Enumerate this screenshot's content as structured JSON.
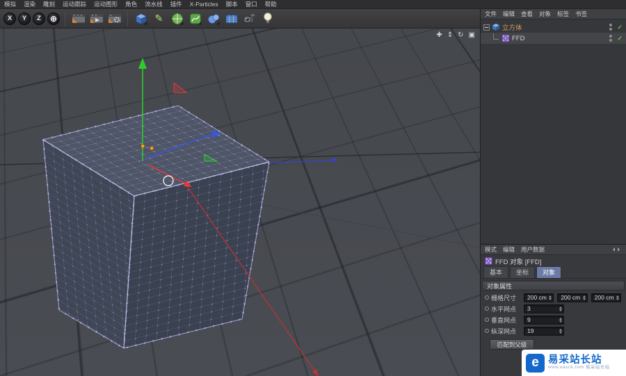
{
  "colors": {
    "axis_x": "#e03c3c",
    "axis_y": "#2ecc2e",
    "axis_z": "#3c55e0",
    "ffd_points": "#c79df2",
    "selected_points": "#ffa228",
    "check_green": "#6dc24f",
    "active_tab": "#6b7ba6",
    "brand_blue": "#1368cb"
  },
  "menubar": {
    "items": [
      "模拟",
      "渲染",
      "雕刻",
      "运动跟踪",
      "运动图形",
      "角色",
      "流水线",
      "插件",
      "X-Particles",
      "脚本",
      "窗口",
      "帮助"
    ]
  },
  "toolbar": {
    "axis_locks": [
      "X",
      "Y",
      "Z"
    ],
    "coord_glyph": "⊕",
    "pen_glyph": "✎"
  },
  "viewport": {
    "controls": [
      {
        "name": "pan-view",
        "glyph": "✚"
      },
      {
        "name": "zoom-view",
        "glyph": "⇕"
      },
      {
        "name": "rotate-view",
        "glyph": "↻"
      },
      {
        "name": "maximize-view",
        "glyph": "▣"
      }
    ]
  },
  "object_manager": {
    "menu": [
      "文件",
      "编辑",
      "查看",
      "对象",
      "标签",
      "书签"
    ],
    "objects": [
      {
        "name": "立方体",
        "enabled_glyph": "✓"
      },
      {
        "name": "FFD",
        "enabled_glyph": "✓"
      }
    ]
  },
  "attribute_manager": {
    "menu": [
      "模式",
      "编辑",
      "用户数据"
    ],
    "title": "FFD 对象 [FFD]",
    "tabs": [
      "基本",
      "坐标",
      "对象"
    ],
    "active_tab": "对象",
    "section_title": "对象属性",
    "rows": [
      {
        "label": "栅格尺寸",
        "values": [
          "200 cm",
          "200 cm",
          "200 cm"
        ]
      },
      {
        "label": "水平网点",
        "values": [
          "3"
        ]
      },
      {
        "label": "垂直网点",
        "values": [
          "9"
        ]
      },
      {
        "label": "纵深网点",
        "values": [
          "19"
        ]
      }
    ],
    "fit_button": "匹配到父级"
  },
  "watermark": {
    "icon_letter": "e",
    "brand": "易采站长站",
    "subtext": "www.easck.com 易采站长站"
  }
}
